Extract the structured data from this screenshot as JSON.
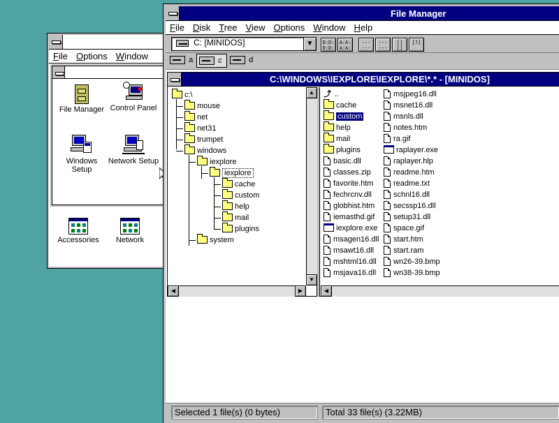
{
  "program_manager": {
    "menu": [
      "File",
      "Options",
      "Window"
    ],
    "main_group": {
      "icons": [
        {
          "label": "File Manager",
          "icon": "file-cabinet-icon"
        },
        {
          "label": "Control Panel",
          "icon": "control-panel-icon"
        },
        {
          "label": "Windows",
          "label2": "Setup",
          "icon": "windows-setup-icon"
        },
        {
          "label": "Network Setup",
          "icon": "network-setup-icon"
        }
      ]
    },
    "group_icons": [
      {
        "label": "Accessories",
        "icon": "group-icon"
      },
      {
        "label": "Network",
        "icon": "group-icon"
      }
    ]
  },
  "file_manager": {
    "title": "File Manager",
    "menu": [
      "File",
      "Disk",
      "Tree",
      "View",
      "Options",
      "Window",
      "Help"
    ],
    "drive_combo": "C: [MINIDOS]",
    "drives": [
      {
        "letter": "a",
        "icon": "floppy-drive-icon"
      },
      {
        "letter": "c",
        "icon": "hard-drive-icon",
        "selected": true
      },
      {
        "letter": "d",
        "icon": "cdrom-drive-icon"
      }
    ],
    "toolbar_glyphs": [
      "D:D: D:D:",
      "A:A: A:A:",
      "--- ---",
      "--- ---",
      "[] []",
      "[?]"
    ],
    "dir_window": {
      "title": "C:\\WINDOWS\\IEXPLORE\\IEXPLORE\\*.* - [MINIDOS]",
      "tree": [
        {
          "name": "c:\\",
          "level": 0
        },
        {
          "name": "mouse",
          "level": 1
        },
        {
          "name": "net",
          "level": 1
        },
        {
          "name": "net31",
          "level": 1
        },
        {
          "name": "trumpet",
          "level": 1
        },
        {
          "name": "windows",
          "level": 1
        },
        {
          "name": "iexplore",
          "level": 2
        },
        {
          "name": "iexplore",
          "level": 3,
          "selected": true
        },
        {
          "name": "cache",
          "level": 4
        },
        {
          "name": "custom",
          "level": 4
        },
        {
          "name": "help",
          "level": 4
        },
        {
          "name": "mail",
          "level": 4
        },
        {
          "name": "plugins",
          "level": 4
        },
        {
          "name": "system",
          "level": 2
        }
      ],
      "files_col1": [
        {
          "name": "..",
          "type": "up"
        },
        {
          "name": "cache",
          "type": "folder"
        },
        {
          "name": "custom",
          "type": "folder",
          "selected": true
        },
        {
          "name": "help",
          "type": "folder"
        },
        {
          "name": "mail",
          "type": "folder"
        },
        {
          "name": "plugins",
          "type": "folder"
        },
        {
          "name": "basic.dll",
          "type": "doc"
        },
        {
          "name": "classes.zip",
          "type": "doc"
        },
        {
          "name": "favorite.htm",
          "type": "doc"
        },
        {
          "name": "fechrcnv.dll",
          "type": "doc"
        },
        {
          "name": "globhist.htm",
          "type": "doc"
        },
        {
          "name": "iemasthd.gif",
          "type": "doc"
        },
        {
          "name": "iexplore.exe",
          "type": "exe"
        },
        {
          "name": "msagen16.dll",
          "type": "doc"
        },
        {
          "name": "msawt16.dll",
          "type": "doc"
        },
        {
          "name": "mshtml16.dll",
          "type": "doc"
        },
        {
          "name": "msjava16.dll",
          "type": "doc"
        }
      ],
      "files_col2": [
        {
          "name": "msjpeg16.dll",
          "type": "doc"
        },
        {
          "name": "msnet16.dll",
          "type": "doc"
        },
        {
          "name": "msnls.dll",
          "type": "doc"
        },
        {
          "name": "notes.htm",
          "type": "doc"
        },
        {
          "name": "ra.gif",
          "type": "doc"
        },
        {
          "name": "raplayer.exe",
          "type": "exe"
        },
        {
          "name": "raplayer.hlp",
          "type": "doc"
        },
        {
          "name": "readme.htm",
          "type": "doc"
        },
        {
          "name": "readme.txt",
          "type": "doc"
        },
        {
          "name": "schnl16.dll",
          "type": "doc"
        },
        {
          "name": "secssp16.dll",
          "type": "doc"
        },
        {
          "name": "setup31.dll",
          "type": "doc"
        },
        {
          "name": "space.gif",
          "type": "doc"
        },
        {
          "name": "start.htm",
          "type": "doc"
        },
        {
          "name": "start.ram",
          "type": "doc"
        },
        {
          "name": "wn26-39.bmp",
          "type": "doc"
        },
        {
          "name": "wn38-39.bmp",
          "type": "doc"
        }
      ]
    },
    "status_left": "Selected 1 file(s) (0 bytes)",
    "status_right": "Total 33 file(s) (3.22MB)"
  },
  "colors": {
    "desktop": "#4fa3a3",
    "active_title": "#000080",
    "selection": "#000080"
  }
}
